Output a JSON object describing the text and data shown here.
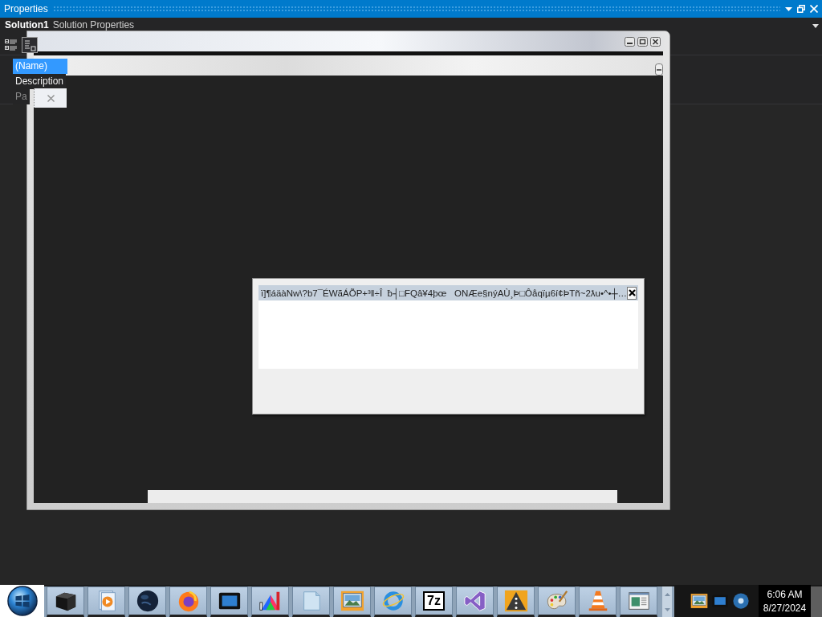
{
  "tool_window": {
    "title": "Properties"
  },
  "properties_header": {
    "object_name": "Solution1",
    "object_type": "Solution Properties"
  },
  "property_rows": [
    {
      "name": "(Name)",
      "selected": true
    },
    {
      "name": "Description",
      "selected": false
    },
    {
      "name": "Pa",
      "selected": false
    }
  ],
  "dialog": {
    "title": "ï]¶áäàNw\\?b7¯ÉWãÁÕP+³ǁ÷Î  ƀ┤□FQâ¥4þœ   ONÆe§nýAÙ¸Þ□Ôåqïµ6í¢ÞTñ~2ƛu•^•┼…"
  },
  "taskbar": {
    "buttons": [
      {
        "kind": "start"
      },
      {
        "kind": "box"
      },
      {
        "kind": "player"
      },
      {
        "kind": "globe"
      },
      {
        "kind": "swirl"
      },
      {
        "kind": "monitor"
      },
      {
        "kind": "chart"
      },
      {
        "kind": "notepad"
      },
      {
        "kind": "picture"
      },
      {
        "kind": "ring"
      },
      {
        "kind": "archive",
        "label": "7z"
      },
      {
        "kind": "loop"
      },
      {
        "kind": "warning"
      },
      {
        "kind": "palette"
      },
      {
        "kind": "cone"
      },
      {
        "kind": "document"
      }
    ],
    "tray": [
      {
        "kind": "picture"
      },
      {
        "kind": "monitor"
      },
      {
        "kind": "disc"
      }
    ],
    "clock": {
      "time": "6:06 AM",
      "date": "8/27/2024"
    }
  }
}
